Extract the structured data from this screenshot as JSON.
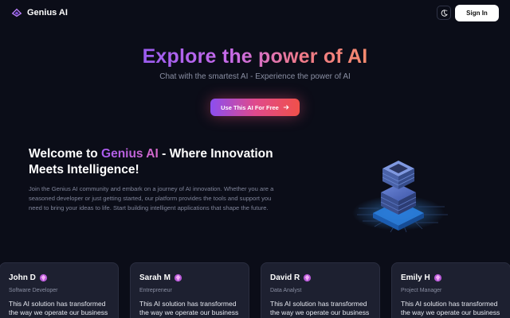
{
  "nav": {
    "brand_name": "Genius AI",
    "brand_icon": "brain-icon",
    "theme_icon": "moon-star-icon",
    "signin_label": "Sign In"
  },
  "hero": {
    "title": "Explore the power of AI",
    "subtitle": "Chat with the smartest AI - Experience the power of AI",
    "cta_label": "Use This AI For Free",
    "cta_icon": "arrow-right-icon"
  },
  "welcome": {
    "title_prefix": "Welcome to ",
    "title_brand": "Genius AI",
    "title_suffix": " - Where Innovation Meets Intelligence!",
    "text": "Join the Genius AI community and embark on a journey of AI innovation. Whether you are a seasoned developer or just getting started, our platform provides the tools and support you need to bring your ideas to life. Start building intelligent applications that shape the future.",
    "illustration_icon": "server-stack-icon"
  },
  "testimonials": [
    {
      "name": "John D",
      "role": "Software Developer",
      "quote": "This AI solution has transformed the way we operate our business"
    },
    {
      "name": "Sarah M",
      "role": "Entrepreneur",
      "quote": "This AI solution has transformed the way we operate our business"
    },
    {
      "name": "David R",
      "role": "Data Analyst",
      "quote": "This AI solution has transformed the way we operate our business"
    },
    {
      "name": "Emily H",
      "role": "Project Manager",
      "quote": "This AI solution has transformed the way we operate our business"
    }
  ],
  "colors": {
    "background": "#0b0d18",
    "card": "#1d2030",
    "accent_purple": "#9b5cf0",
    "accent_pink": "#e04a8c",
    "accent_red": "#f0504a"
  }
}
